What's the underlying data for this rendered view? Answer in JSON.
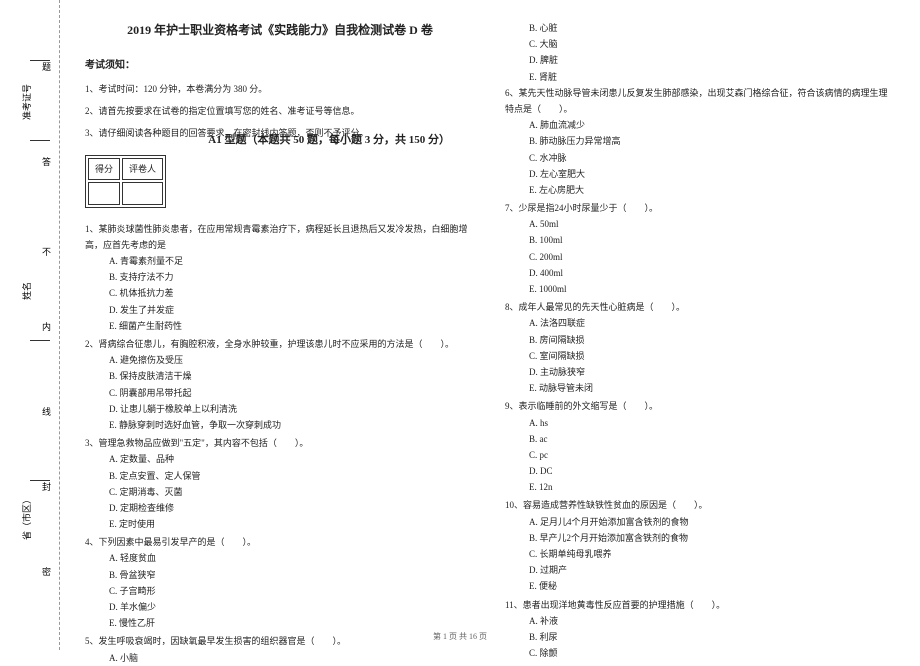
{
  "margin": {
    "label1": "准考证号",
    "label2": "姓名",
    "label3": "省（市区）",
    "char1": "不",
    "char2": "内",
    "char3": "线",
    "char4": "封",
    "char5": "密",
    "char6": "答",
    "char7": "题"
  },
  "title": "2019 年护士职业资格考试《实践能力》自我检测试卷 D 卷",
  "notice_heading": "考试须知：",
  "instructions": {
    "i1": "1、考试时间：120 分钟，本卷满分为 380 分。",
    "i2": "2、请首先按要求在试卷的指定位置填写您的姓名、准考证号等信息。",
    "i3": "3、请仔细阅读各种题目的回答要求，在密封线内答题，否则不予评分。"
  },
  "score_table": {
    "h1": "得分",
    "h2": "评卷人"
  },
  "section_a1": "A1 型题（本题共 50 题，每小题 3 分，共 150 分）",
  "q1": {
    "stem": "1、某肺炎球菌性肺炎患者，在应用常规青霉素治疗下，病程延长且退热后又发冷发热，白细胞增高，应首先考虑的是",
    "a": "A. 青霉素剂量不足",
    "b": "B. 支持疗法不力",
    "c": "C. 机体抵抗力差",
    "d": "D. 发生了并发症",
    "e": "E. 细菌产生耐药性"
  },
  "q2": {
    "stem": "2、肾病综合征患儿，有胸腔积液，全身水肿较重，护理该患儿时不应采用的方法是（　　）。",
    "a": "A. 避免擦伤及受压",
    "b": "B. 保持皮肤清洁干燥",
    "c": "C. 阴囊部用吊带托起",
    "d": "D. 让患儿躺于橡胶单上以利清洗",
    "e": "E. 静脉穿刺时选好血管，争取一次穿刺成功"
  },
  "q3": {
    "stem": "3、管理急救物品应做到\"五定\"，其内容不包括（　　）。",
    "a": "A. 定数量、品种",
    "b": "B. 定点安置、定人保管",
    "c": "C. 定期消毒、灭菌",
    "d": "D. 定期检查维修",
    "e": "E. 定时使用"
  },
  "q4": {
    "stem": "4、下列因素中最易引发早产的是（　　）。",
    "a": "A. 轻度贫血",
    "b": "B. 骨盆狭窄",
    "c": "C. 子宫畸形",
    "d": "D. 羊水偏少",
    "e": "E. 慢性乙肝"
  },
  "q5": {
    "stem": "5、发生呼吸衰竭时，因缺氧最早发生损害的组织器官是（　　）。",
    "a": "A. 小脑",
    "b": "B. 心脏",
    "c": "C. 大脑",
    "d": "D. 脾脏",
    "e": "E. 肾脏"
  },
  "q6": {
    "stem": "6、某先天性动脉导管未闭患儿反复发生肺部感染，出现艾森门格综合征，符合该病情的病理生理特点是（　　）。",
    "a": "A. 肺血流减少",
    "b": "B. 肺动脉压力异常增高",
    "c": "C. 水冲脉",
    "d": "D. 左心室肥大",
    "e": "E. 左心房肥大"
  },
  "q7": {
    "stem": "7、少尿是指24小时尿量少于（　　）。",
    "a": "A. 50ml",
    "b": "B. 100ml",
    "c": "C. 200ml",
    "d": "D. 400ml",
    "e": "E. 1000ml"
  },
  "q8": {
    "stem": "8、成年人最常见的先天性心脏病是（　　）。",
    "a": "A. 法洛四联症",
    "b": "B. 房间隔缺损",
    "c": "C. 室间隔缺损",
    "d": "D. 主动脉狭窄",
    "e": "E. 动脉导管未闭"
  },
  "q9": {
    "stem": "9、表示临睡前的外文缩写是（　　）。",
    "a": "A. hs",
    "b": "B. ac",
    "c": "C. pc",
    "d": "D. DC",
    "e": "E. 12n"
  },
  "q10": {
    "stem": "10、容易造成营养性缺铁性贫血的原因是（　　）。",
    "a": "A. 足月儿4个月开始添加富含铁剂的食物",
    "b": "B. 早产儿2个月开始添加富含铁剂的食物",
    "c": "C. 长期单纯母乳喂养",
    "d": "D. 过期产",
    "e": "E. 便秘"
  },
  "q11": {
    "stem": "11、患者出现洋地黄毒性反应首要的护理措施（　　）。",
    "a": "A. 补液",
    "b": "B. 利尿",
    "c": "C. 除颤"
  },
  "footer": "第 1 页 共 16 页"
}
